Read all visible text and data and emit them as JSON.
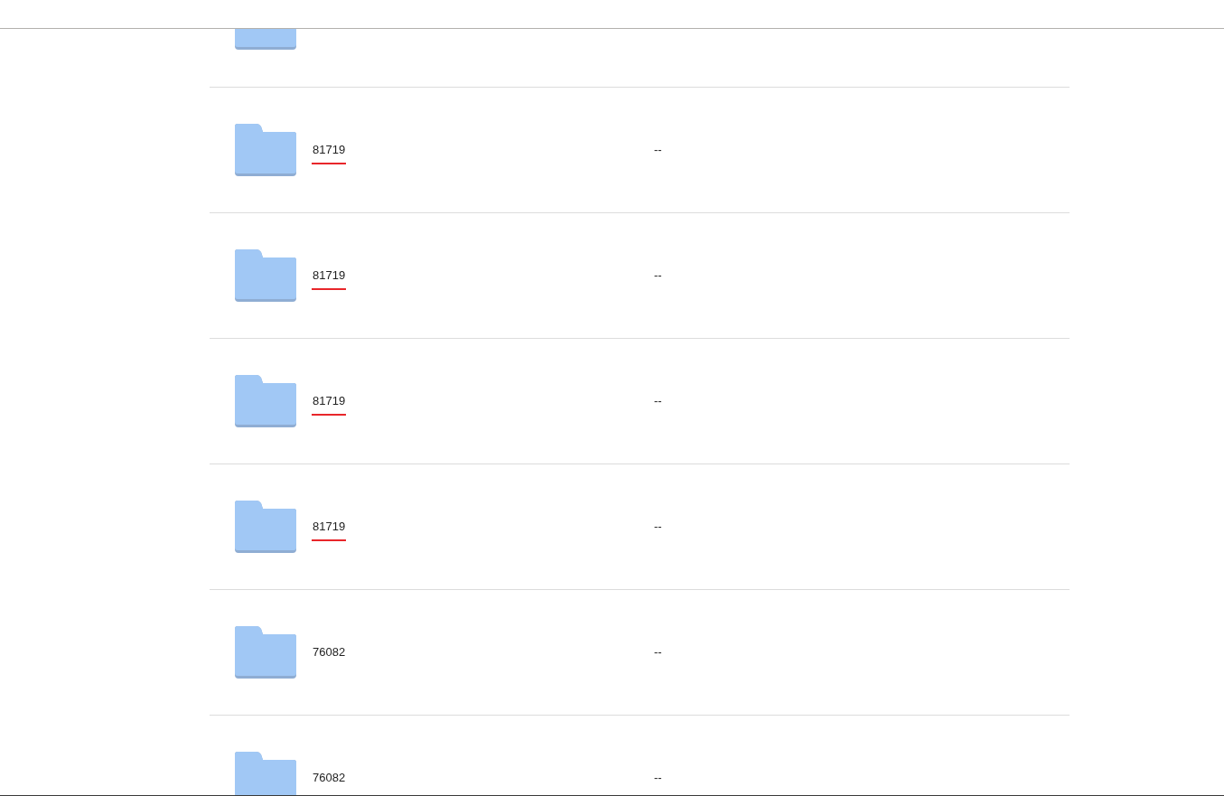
{
  "rows": [
    {
      "kind": "partial"
    },
    {
      "kind": "folder",
      "name": "81719",
      "modified": "--",
      "red_underline": true
    },
    {
      "kind": "folder",
      "name": "81719",
      "modified": "--",
      "red_underline": true
    },
    {
      "kind": "folder",
      "name": "81719",
      "modified": "--",
      "red_underline": true
    },
    {
      "kind": "folder",
      "name": "81719",
      "modified": "--",
      "red_underline": true
    },
    {
      "kind": "folder",
      "name": "76082",
      "modified": "--",
      "red_underline": false
    },
    {
      "kind": "folder",
      "name": "76082",
      "modified": "--",
      "red_underline": false
    }
  ]
}
